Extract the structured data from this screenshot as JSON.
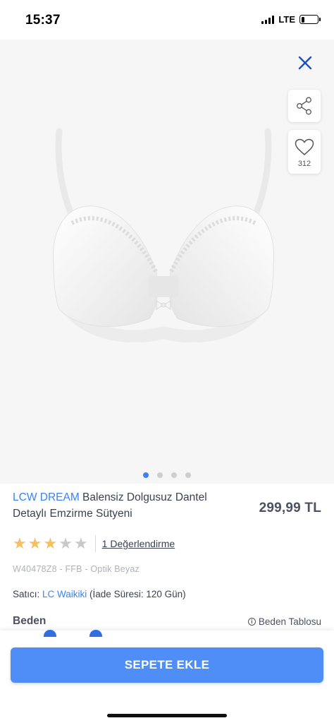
{
  "status_bar": {
    "time": "15:37",
    "network": "LTE",
    "battery_level": 0.2
  },
  "gallery": {
    "image_count": 4,
    "active_index": 0,
    "favorite_count": "312",
    "icons": {
      "close": "close-icon",
      "share": "share-icon",
      "favorite": "heart-icon"
    }
  },
  "product": {
    "brand": "LCW DREAM",
    "name": " Balensiz Dolgusuz Dantel Detaylı Emzirme Sütyeni",
    "price": "299,99 TL",
    "rating": 3,
    "rating_max": 5,
    "reviews_label": "1 Değerlendirme",
    "sku": "W40478Z8 - FFB - Optik Beyaz",
    "seller_prefix": "Satıcı: ",
    "seller_name": "LC Waikiki",
    "seller_suffix": " (İade Süresi: 120 Gün)"
  },
  "size": {
    "title": "Beden",
    "chart_label": "Beden Tablosu"
  },
  "actions": {
    "add_to_cart": "SEPETE EKLE"
  },
  "colors": {
    "accent": "#3b82f6",
    "button": "#4f8ef7",
    "star_filled": "#f3c164",
    "star_empty": "#c9c9c9"
  }
}
